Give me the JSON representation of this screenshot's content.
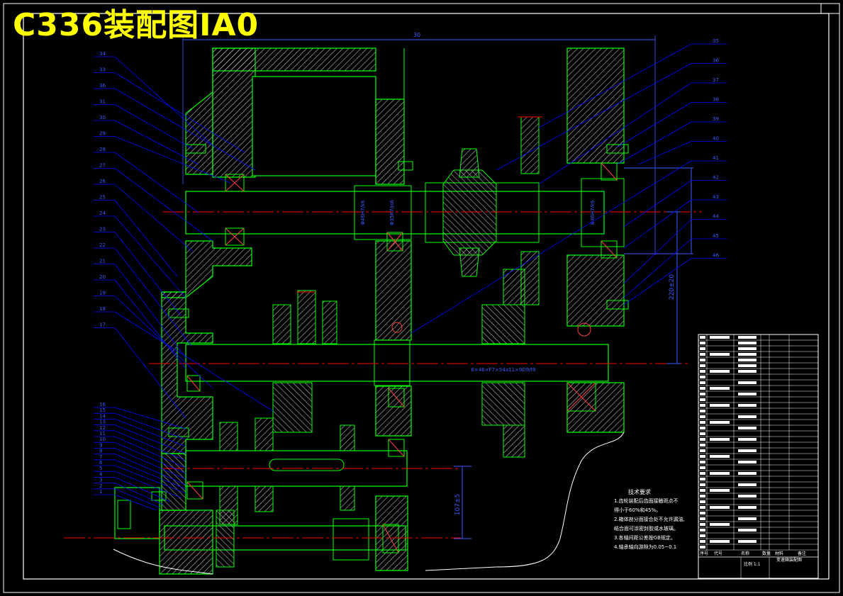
{
  "title": "C336装配图IA0",
  "colors": {
    "background": "#000000",
    "frame": "#ffffff",
    "outline": "#00ff00",
    "leader": "#0000ff",
    "centerline": "#ff0000",
    "hatch": "#bfbfbf",
    "title_text": "#ffff00",
    "dimension": "#3a5cff",
    "highlight": "#ff4040",
    "notes": "#ffffff"
  },
  "top_dimension": "30",
  "balloons_left": [
    "34",
    "33",
    "36",
    "31",
    "30",
    "29",
    "28",
    "27",
    "26",
    "25",
    "24",
    "23",
    "22",
    "21",
    "20",
    "19",
    "18",
    "17",
    "16",
    "15",
    "14",
    "13",
    "12",
    "11",
    "10",
    "9",
    "8",
    "7",
    "6",
    "5",
    "4",
    "3",
    "2",
    "1"
  ],
  "balloons_right": [
    "35",
    "36",
    "37",
    "38",
    "39",
    "40",
    "41",
    "42",
    "43",
    "44",
    "45",
    "46"
  ],
  "dimensions": {
    "fit1": "Φ46H7/k6",
    "fit2": "Φ35K7/js6",
    "fit3": "Φ46H7/k6",
    "spline": "6×46×F7×54a11×9D9/f8",
    "center1": "107±5",
    "center2": "220±20"
  },
  "notes": {
    "heading": "技术要求",
    "lines": [
      "1.齿轮装配后齿面接触斑点不",
      "  得小于60%和45%。",
      "2.箱体剖分面接合处不允许漏油,",
      "  结合面可涂密封胶或水玻璃。",
      "3.各轴间距公差按GB规定。",
      "4.轴承轴向游隙为0.05~0.1"
    ]
  },
  "bom": {
    "col_headers": [
      "序号",
      "代号",
      "名称",
      "数量",
      "材料",
      "备注"
    ],
    "title_block": "变速箱装配图",
    "scale_label": "比例",
    "scale": "1:1"
  }
}
